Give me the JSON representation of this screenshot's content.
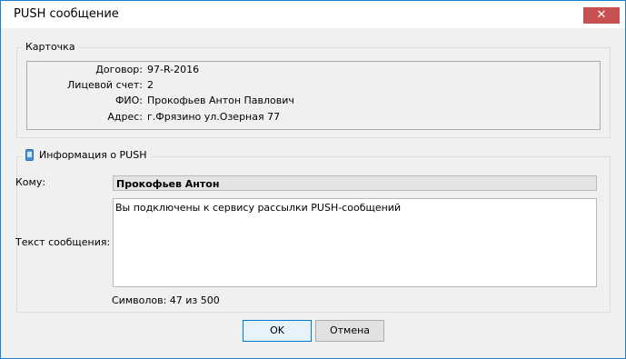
{
  "window": {
    "title": "PUSH сообщение",
    "close_glyph": "✕"
  },
  "card": {
    "legend": "Карточка",
    "rows": [
      {
        "label": "Договор:",
        "value": "97-R-2016"
      },
      {
        "label": "Лицевой счет:",
        "value": "2"
      },
      {
        "label": "ФИО:",
        "value": "Прокофьев Антон Павлович"
      },
      {
        "label": "Адрес:",
        "value": "г.Фрязино ул.Озерная 77"
      }
    ]
  },
  "push": {
    "legend": "Информация о PUSH",
    "legend_icon": "phone-icon",
    "to_label": "Кому:",
    "to_value": "Прокофьев Антон",
    "text_label": "Текст сообщения:",
    "text_value": "Вы подключены к сервису рассылки PUSH-сообщений",
    "counter": "Символов: 47 из 500"
  },
  "buttons": {
    "ok": "OK",
    "cancel": "Отмена"
  },
  "colors": {
    "close_button": "#c75050",
    "window_border": "#1883d7",
    "dialog_bg": "#f0f0f0"
  }
}
